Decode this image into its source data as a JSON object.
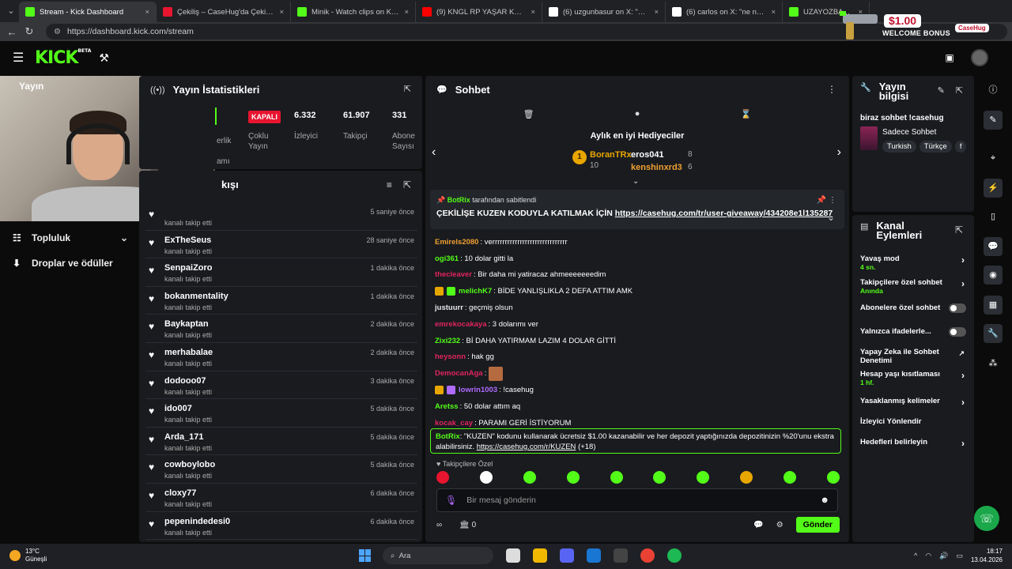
{
  "browser": {
    "tabs": [
      {
        "title": "Stream - Kick Dashboard",
        "icon": "kick-icon",
        "color": "#53fc18",
        "active": true
      },
      {
        "title": "Çekiliş – CaseHug'da Çekilişlere K",
        "icon": "casehug-icon",
        "color": "#e7152f"
      },
      {
        "title": "Minik - Watch clips on Kick",
        "icon": "kick-icon",
        "color": "#53fc18"
      },
      {
        "title": "(9) KNGL RP YAŞAR KAÇAR - YouT",
        "icon": "youtube-icon",
        "color": "#ff0000"
      },
      {
        "title": "(6) uzgunbasur on X: \"https://t.co",
        "icon": "x-icon",
        "color": "#ffffff"
      },
      {
        "title": "(6) carlos on X: \"ne nova gürkan n",
        "icon": "x-icon",
        "color": "#ffffff"
      },
      {
        "title": "UZAYOZBAY Clips - Watch",
        "icon": "kick-icon",
        "color": "#53fc18"
      }
    ],
    "url": "https://dashboard.kick.com/stream",
    "ad": {
      "amount": "$1.00",
      "label": "WELCOME BONUS",
      "brand": "CaseHug"
    }
  },
  "header": {
    "logo": "KICK",
    "logo_sup": "BETA"
  },
  "camera": {
    "label": "Yayın"
  },
  "sidebar": {
    "items": [
      {
        "label": "Topluluk",
        "icon": "community-icon"
      },
      {
        "label": "Droplar ve ödüller",
        "icon": "drops-icon"
      }
    ]
  },
  "stats": {
    "title": "Yayın İstatistikleri",
    "status": "KAPALI",
    "status_label": "Çoklu Yayın",
    "hidden_label": "erlik",
    "hidden_label2": "amı",
    "values": [
      {
        "value": "6.332",
        "label": "İzleyici"
      },
      {
        "value": "61.907",
        "label": "Takipçi"
      },
      {
        "value": "331",
        "label": "Abone Sayısı"
      }
    ]
  },
  "activity": {
    "title": "kışı",
    "items": [
      {
        "user": "",
        "sub": "kanalı takip etti",
        "time": "5 saniye önce"
      },
      {
        "user": "ExTheSeus",
        "sub": "kanalı takip etti",
        "time": "28 saniye önce"
      },
      {
        "user": "SenpaiZoro",
        "sub": "kanalı takip etti",
        "time": "1 dakika önce"
      },
      {
        "user": "bokanmentality",
        "sub": "kanalı takip etti",
        "time": "1 dakika önce"
      },
      {
        "user": "Baykaptan",
        "sub": "kanalı takip etti",
        "time": "2 dakika önce"
      },
      {
        "user": "merhabalae",
        "sub": "kanalı takip etti",
        "time": "2 dakika önce"
      },
      {
        "user": "dodooo07",
        "sub": "kanalı takip etti",
        "time": "3 dakika önce"
      },
      {
        "user": "ido007",
        "sub": "kanalı takip etti",
        "time": "5 dakika önce"
      },
      {
        "user": "Arda_171",
        "sub": "kanalı takip etti",
        "time": "5 dakika önce"
      },
      {
        "user": "cowboylobo",
        "sub": "kanalı takip etti",
        "time": "5 dakika önce"
      },
      {
        "user": "cloxy77",
        "sub": "kanalı takip etti",
        "time": "6 dakika önce"
      },
      {
        "user": "pepenindedesi0",
        "sub": "kanalı takip etti",
        "time": "6 dakika önce"
      }
    ]
  },
  "chat": {
    "title": "Sohbet",
    "gifters_title": "Aylık en iyi Hediyeciler",
    "gifters": [
      {
        "rank": "1",
        "name": "BoranTRx",
        "count": "10"
      },
      {
        "name": "eros041",
        "count": "8"
      },
      {
        "name": "kenshinxrd3",
        "count": "6"
      }
    ],
    "pinned_by": "BotRix",
    "pinned_by_suffix": "tarafından sabitlendi",
    "pinned_text": "ÇEKİLİŞE KUZEN KODUYLA KATILMAK İÇİN",
    "pinned_link": "https://casehug.com/tr/user-giveaway/434208e1l135287",
    "messages": [
      {
        "user": "Emirels2080",
        "color": "#f0a030",
        "text": "verrrrrrrrrrrrrrrrrrrrrrrrrrrrrr"
      },
      {
        "user": "ogi361",
        "color": "#53fc18",
        "text": "10 dolar gitti la"
      },
      {
        "user": "thecleaver",
        "color": "#e0245e",
        "text": "Bir daha mi yatiracaz ahmeeeeeeedim"
      },
      {
        "user": "melichK7",
        "color": "#53fc18",
        "text": "BİDE YANLIŞLIKLA 2 DEFA ATTIM AMK",
        "badges": true
      },
      {
        "user": "justuurr",
        "color": "#e8e8e8",
        "text": "geçmiş olsun"
      },
      {
        "user": "emrekocakaya",
        "color": "#e0245e",
        "text": "3 dolarımı ver"
      },
      {
        "user": "Zixi232",
        "color": "#53fc18",
        "text": "Bİ DAHA YATIRMAM LAZIM 4 DOLAR GİTTİ"
      },
      {
        "user": "heysonn",
        "color": "#e0245e",
        "text": "hak gg"
      },
      {
        "user": "DemocanAga",
        "color": "#e0245e",
        "text": ""
      },
      {
        "user": "lowrin1003",
        "color": "#b06bff",
        "text": "!casehug",
        "badges": true
      },
      {
        "user": "Aretss",
        "color": "#53fc18",
        "text": "50 dolar attım aq"
      },
      {
        "user": "kocak_cay",
        "color": "#e0245e",
        "text": "PARAMI GERİ İSTİYORUM"
      }
    ],
    "bot_user": "BotRix",
    "bot_text": "\"KUZEN\" kodunu kullanarak ücretsiz $1.00 kazanabilir ve her depozit yaptığınızda depozitinizin %20'unu ekstra alabilirsiniz.",
    "bot_link": "https://casehug.com/r/KUZEN",
    "bot_suffix": "(+18)",
    "follow_only": "Takipçilere Özel",
    "input_placeholder": "Bir mesaj gönderin",
    "points": "0",
    "send_label": "Gönder"
  },
  "stream_info": {
    "title": "Yayın bilgisi",
    "stream_title": "biraz sohbet !casehug",
    "category": "Sadece Sohbet",
    "tags": [
      "Turkish",
      "Türkçe",
      "f"
    ]
  },
  "channel_actions": {
    "title": "Kanal Eylemleri",
    "options": [
      {
        "label": "Yavaş mod",
        "sub": "4 sn.",
        "control": "arrow"
      },
      {
        "label": "Takipçilere özel sohbet",
        "sub": "Anında",
        "control": "arrow"
      },
      {
        "label": "Abonelere özel sohbet",
        "sub": "",
        "control": "toggle"
      },
      {
        "label": "Yalnızca ifadelerle...",
        "sub": "",
        "control": "toggle"
      },
      {
        "label": "Yapay Zeka ile Sohbet Denetimi",
        "sub": "",
        "control": "external"
      },
      {
        "label": "Hesap yaşı kısıtlaması",
        "sub": "1 hf.",
        "control": "arrow"
      },
      {
        "label": "Yasaklanmış kelimeler",
        "sub": "",
        "control": "arrow"
      },
      {
        "label": "İzleyici Yönlendir",
        "sub": "",
        "control": "none"
      },
      {
        "label": "Hedefleri belirleyin",
        "sub": "",
        "control": "arrow"
      }
    ]
  },
  "taskbar": {
    "temp": "13°C",
    "weather": "Güneşli",
    "search": "Ara",
    "time": "18:17",
    "date": "13.04.2026"
  }
}
